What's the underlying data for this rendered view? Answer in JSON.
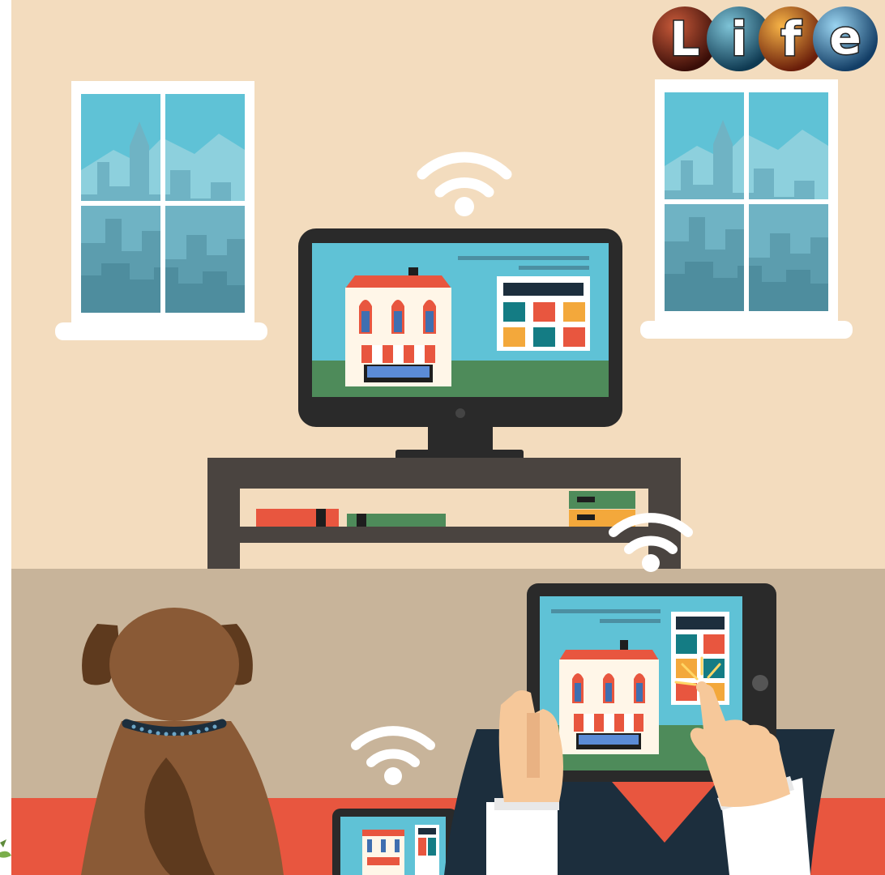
{
  "scene": {
    "subject": "smart-home-illustration",
    "colors": {
      "wall": "#F3DCBE",
      "floor_band": "#C8B49A",
      "sofa": "#E8563F",
      "window_frame": "#FFFFFF",
      "sky": "#5FC2D6",
      "tv_body": "#2A2A2A",
      "screen_bg": "#5FC2D6",
      "screen_grass": "#4E8B5A",
      "furniture": "#4A4440",
      "dog": "#8A5A36",
      "shirt": "#1C2E3D"
    },
    "icons": [
      "wifi-icon",
      "wifi-icon",
      "wifi-icon"
    ]
  },
  "logo": {
    "letters": [
      "L",
      "i",
      "f",
      "e"
    ],
    "colors": [
      "#7A2A1A",
      "#2D6A84",
      "#C9601E",
      "#3C7FA6"
    ]
  }
}
